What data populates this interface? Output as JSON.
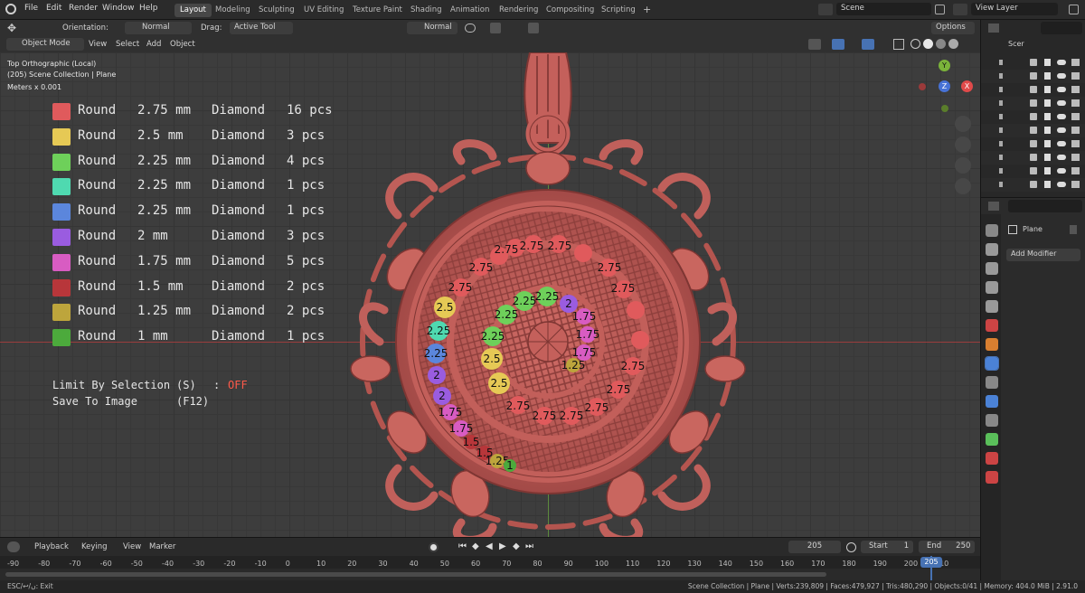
{
  "menu": {
    "items": [
      "File",
      "Edit",
      "Render",
      "Window",
      "Help"
    ]
  },
  "workspaces": {
    "items": [
      "Layout",
      "Modeling",
      "Sculpting",
      "UV Editing",
      "Texture Paint",
      "Shading",
      "Animation",
      "Rendering",
      "Compositing",
      "Scripting"
    ],
    "add": "+"
  },
  "scene": {
    "label": "Scene",
    "view_layer": "View Layer"
  },
  "tool_header": {
    "orientation_label": "Orientation:",
    "orientation_value": "Normal",
    "drag_label": "Drag:",
    "drag_value": "Active Tool",
    "snap_orientation": "Normal",
    "options_label": "Options"
  },
  "viewport_header": {
    "mode": "Object Mode",
    "menus": [
      "View",
      "Select",
      "Add",
      "Object"
    ]
  },
  "viewport_info": {
    "view": "Top Orthographic (Local)",
    "collection": "(205) Scene Collection | Plane",
    "units": "Meters x 0.001"
  },
  "gizmo": {
    "y": "Y",
    "x": "X",
    "z": "Z"
  },
  "legend": [
    {
      "shape": "Round",
      "size": "2.75 mm",
      "stone": "Diamond",
      "qty": "16 pcs",
      "color": "#e05a5c"
    },
    {
      "shape": "Round",
      "size": "2.5 mm",
      "stone": "Diamond",
      "qty": "3 pcs",
      "color": "#e6c955"
    },
    {
      "shape": "Round",
      "size": "2.25 mm",
      "stone": "Diamond",
      "qty": "4 pcs",
      "color": "#6ed05a"
    },
    {
      "shape": "Round",
      "size": "2.25 mm",
      "stone": "Diamond",
      "qty": "1 pcs",
      "color": "#4fd9b0"
    },
    {
      "shape": "Round",
      "size": "2.25 mm",
      "stone": "Diamond",
      "qty": "1 pcs",
      "color": "#5b86dc"
    },
    {
      "shape": "Round",
      "size": "2 mm",
      "stone": "Diamond",
      "qty": "3 pcs",
      "color": "#9a5ce0"
    },
    {
      "shape": "Round",
      "size": "1.75 mm",
      "stone": "Diamond",
      "qty": "5 pcs",
      "color": "#d85cc2"
    },
    {
      "shape": "Round",
      "size": "1.5 mm",
      "stone": "Diamond",
      "qty": "2 pcs",
      "color": "#b8363a"
    },
    {
      "shape": "Round",
      "size": "1.25 mm",
      "stone": "Diamond",
      "qty": "2 pcs",
      "color": "#bda53c"
    },
    {
      "shape": "Round",
      "size": "1 mm",
      "stone": "Diamond",
      "qty": "1 pcs",
      "color": "#4caa3c"
    }
  ],
  "options": {
    "limit_label": "Limit By Selection",
    "limit_key": "(S)",
    "limit_sep": ":",
    "limit_value": "OFF",
    "save_label": "Save To Image",
    "save_key": "(F12)"
  },
  "stone_labels": {
    "r275": "2.75",
    "r25": "2.5",
    "r225": "2.25",
    "r2": "2",
    "r175": "1.75",
    "r15": "1.5",
    "r125": "1.25",
    "r1": "1"
  },
  "outliner": {
    "title": "Scer"
  },
  "properties": {
    "object_name": "Plane",
    "add_modifier": "Add Modifier"
  },
  "timeline": {
    "menus": [
      "Playback",
      "Keying",
      "View",
      "Marker"
    ],
    "current_frame": "205",
    "start_label": "Start",
    "start_value": "1",
    "end_label": "End",
    "end_value": "250",
    "ticks": [
      "-90",
      "-80",
      "-70",
      "-60",
      "-50",
      "-40",
      "-30",
      "-20",
      "-10",
      "0",
      "10",
      "20",
      "30",
      "40",
      "50",
      "60",
      "70",
      "80",
      "90",
      "100",
      "110",
      "120",
      "130",
      "140",
      "150",
      "160",
      "170",
      "180",
      "190",
      "200",
      "210"
    ],
    "playhead": "205"
  },
  "status": {
    "left": "ESC/↩/ں: Exit",
    "right": "Scene Collection | Plane | Verts:239,809 | Faces:479,927 | Tris:480,290 | Objects:0/41 | Memory: 404.0 MiB | 2.91.0"
  },
  "colors": {
    "accent": "#4772b3",
    "pendant": "#c8625e",
    "pendant_dark": "#8e3f3c",
    "off": "#ff5a4a"
  }
}
